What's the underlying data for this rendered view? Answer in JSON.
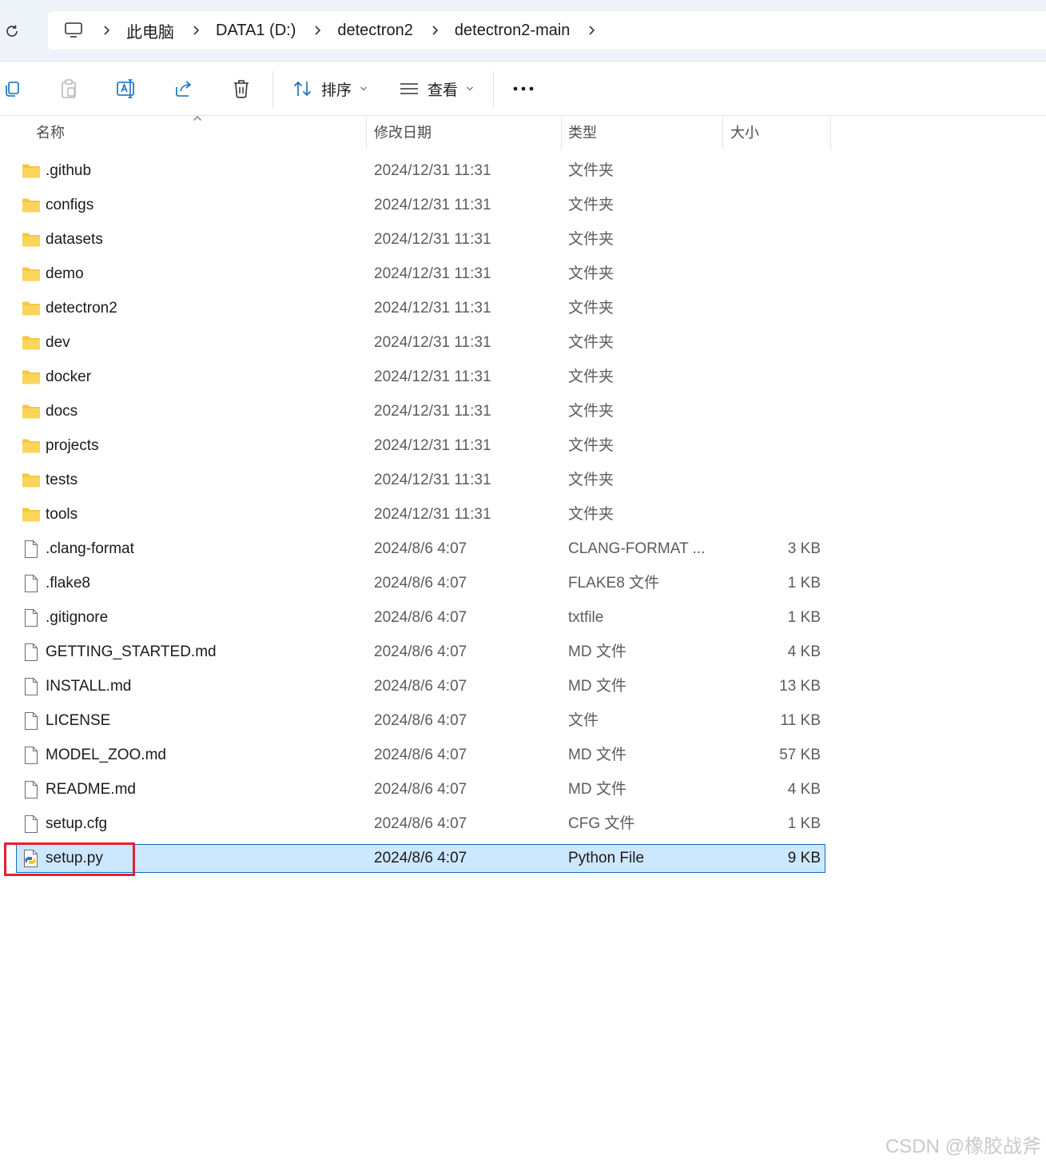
{
  "address_bar": {
    "crumbs": [
      "此电脑",
      "DATA1 (D:)",
      "detectron2",
      "detectron2-main"
    ]
  },
  "toolbar": {
    "sort_label": "排序",
    "view_label": "查看"
  },
  "columns": {
    "name": "名称",
    "date": "修改日期",
    "type": "类型",
    "size": "大小"
  },
  "files": [
    {
      "name": ".github",
      "date": "2024/12/31 11:31",
      "type": "文件夹",
      "size": "",
      "icon": "folder-icon"
    },
    {
      "name": "configs",
      "date": "2024/12/31 11:31",
      "type": "文件夹",
      "size": "",
      "icon": "folder-icon"
    },
    {
      "name": "datasets",
      "date": "2024/12/31 11:31",
      "type": "文件夹",
      "size": "",
      "icon": "folder-icon"
    },
    {
      "name": "demo",
      "date": "2024/12/31 11:31",
      "type": "文件夹",
      "size": "",
      "icon": "folder-icon"
    },
    {
      "name": "detectron2",
      "date": "2024/12/31 11:31",
      "type": "文件夹",
      "size": "",
      "icon": "folder-icon"
    },
    {
      "name": "dev",
      "date": "2024/12/31 11:31",
      "type": "文件夹",
      "size": "",
      "icon": "folder-icon"
    },
    {
      "name": "docker",
      "date": "2024/12/31 11:31",
      "type": "文件夹",
      "size": "",
      "icon": "folder-icon"
    },
    {
      "name": "docs",
      "date": "2024/12/31 11:31",
      "type": "文件夹",
      "size": "",
      "icon": "folder-icon"
    },
    {
      "name": "projects",
      "date": "2024/12/31 11:31",
      "type": "文件夹",
      "size": "",
      "icon": "folder-icon"
    },
    {
      "name": "tests",
      "date": "2024/12/31 11:31",
      "type": "文件夹",
      "size": "",
      "icon": "folder-icon"
    },
    {
      "name": "tools",
      "date": "2024/12/31 11:31",
      "type": "文件夹",
      "size": "",
      "icon": "folder-icon"
    },
    {
      "name": ".clang-format",
      "date": "2024/8/6 4:07",
      "type": "CLANG-FORMAT ...",
      "size": "3 KB",
      "icon": "file-icon"
    },
    {
      "name": ".flake8",
      "date": "2024/8/6 4:07",
      "type": "FLAKE8 文件",
      "size": "1 KB",
      "icon": "file-icon"
    },
    {
      "name": ".gitignore",
      "date": "2024/8/6 4:07",
      "type": "txtfile",
      "size": "1 KB",
      "icon": "file-icon"
    },
    {
      "name": "GETTING_STARTED.md",
      "date": "2024/8/6 4:07",
      "type": "MD 文件",
      "size": "4 KB",
      "icon": "file-icon"
    },
    {
      "name": "INSTALL.md",
      "date": "2024/8/6 4:07",
      "type": "MD 文件",
      "size": "13 KB",
      "icon": "file-icon"
    },
    {
      "name": "LICENSE",
      "date": "2024/8/6 4:07",
      "type": "文件",
      "size": "11 KB",
      "icon": "file-icon"
    },
    {
      "name": "MODEL_ZOO.md",
      "date": "2024/8/6 4:07",
      "type": "MD 文件",
      "size": "57 KB",
      "icon": "file-icon"
    },
    {
      "name": "README.md",
      "date": "2024/8/6 4:07",
      "type": "MD 文件",
      "size": "4 KB",
      "icon": "file-icon"
    },
    {
      "name": "setup.cfg",
      "date": "2024/8/6 4:07",
      "type": "CFG 文件",
      "size": "1 KB",
      "icon": "file-icon"
    },
    {
      "name": "setup.py",
      "date": "2024/8/6 4:07",
      "type": "Python File",
      "size": "9 KB",
      "icon": "python-file-icon",
      "selected": true
    }
  ],
  "colors": {
    "selection_bg": "#cce8ff",
    "selection_border": "#0f6cbd",
    "annotation_box": "#e5202d",
    "folder": "#f8c63d"
  },
  "watermark": "CSDN @橡胶战斧"
}
